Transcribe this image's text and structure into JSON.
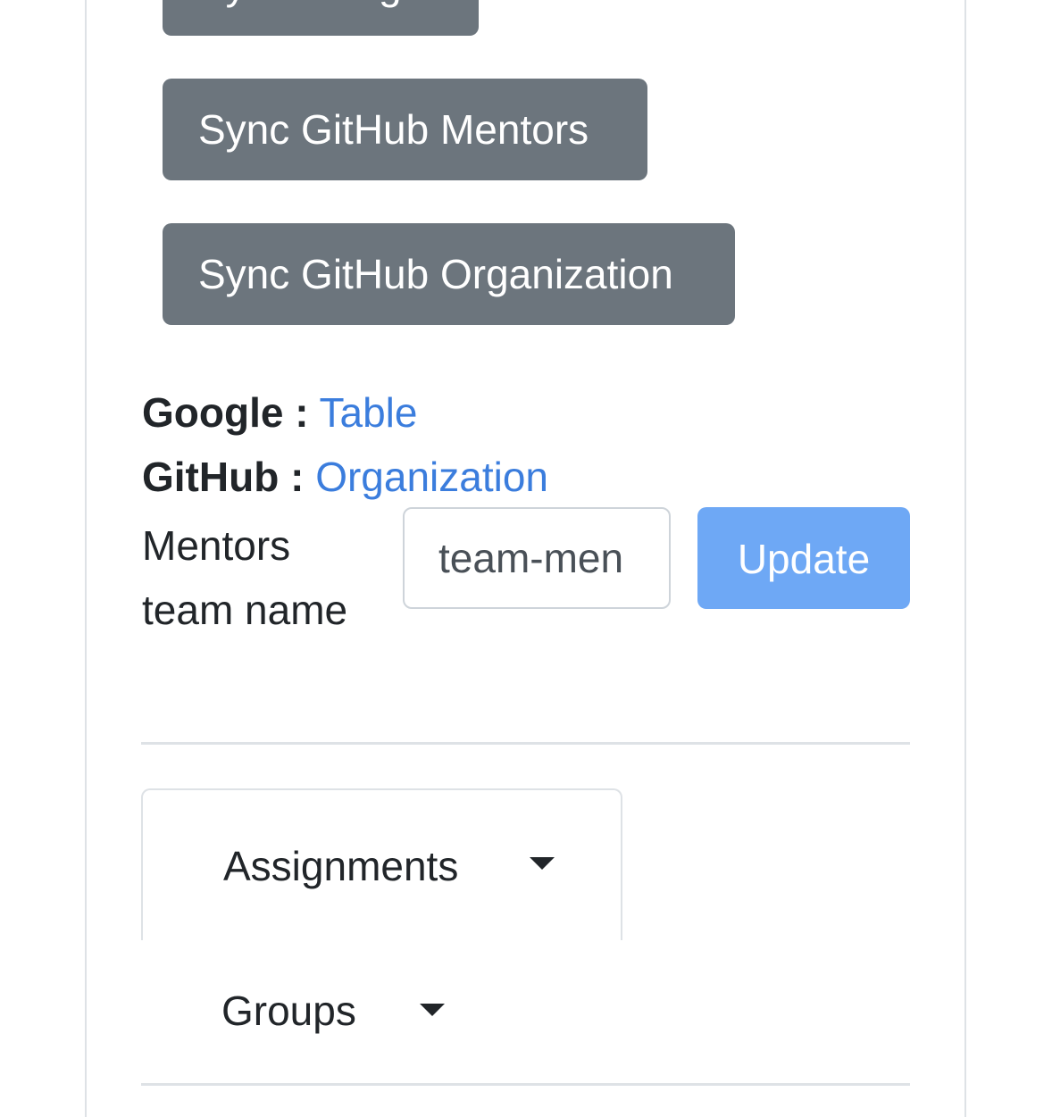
{
  "sync_buttons": {
    "google_label": "Sync Google",
    "mentors_label": "Sync GitHub Mentors",
    "organization_label": "Sync GitHub Organization"
  },
  "links": {
    "google_key": "Google",
    "google_link_text": "Table",
    "github_key": "GitHub",
    "github_link_text": "Organization",
    "separator": ":"
  },
  "mentors_form": {
    "label": "Mentors team name",
    "input_value": "team-men",
    "update_label": "Update"
  },
  "tabs": [
    {
      "label": "Assignments",
      "active": true
    },
    {
      "label": "Groups",
      "active": false
    }
  ],
  "colors": {
    "secondary_button": "#6c757d",
    "primary_disabled": "#6ea8f5",
    "link": "#3b7ddd",
    "border": "#dee2e6"
  }
}
